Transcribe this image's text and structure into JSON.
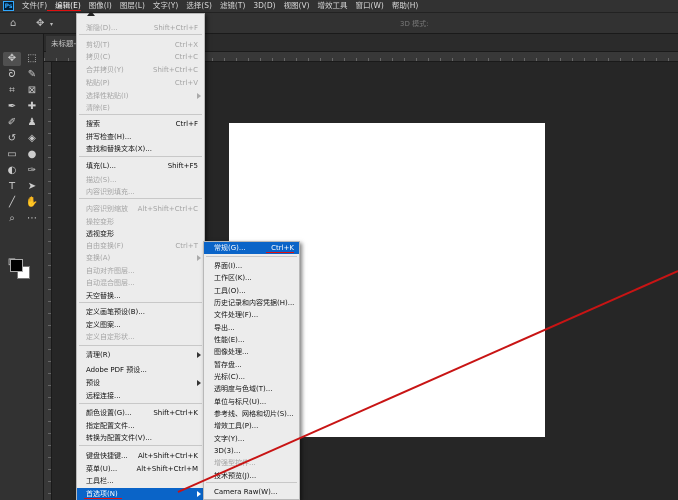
{
  "app": {
    "logo": "Ps"
  },
  "menubar": {
    "items": [
      "文件(F)",
      "编辑(E)",
      "图像(I)",
      "图层(L)",
      "文字(Y)",
      "选择(S)",
      "滤镜(T)",
      "3D(D)",
      "视图(V)",
      "增效工具",
      "窗口(W)",
      "帮助(H)"
    ]
  },
  "options": {
    "mode_label": "3D 模式:"
  },
  "document": {
    "tab_title": "未标题-"
  },
  "edit_menu": {
    "items": [
      {
        "label": "渐隐(D)...",
        "shortcut": "Shift+Ctrl+F",
        "disabled": true
      },
      {
        "label": "剪切(T)",
        "shortcut": "Ctrl+X",
        "disabled": true
      },
      {
        "label": "拷贝(C)",
        "shortcut": "Ctrl+C",
        "disabled": true
      },
      {
        "label": "合并拷贝(Y)",
        "shortcut": "Shift+Ctrl+C",
        "disabled": true
      },
      {
        "label": "粘贴(P)",
        "shortcut": "Ctrl+V",
        "disabled": true
      },
      {
        "label": "选择性粘贴(I)",
        "shortcut": "",
        "disabled": true,
        "submenu": true
      },
      {
        "label": "清除(E)",
        "shortcut": "",
        "disabled": true
      },
      {
        "label": "搜索",
        "shortcut": "Ctrl+F",
        "disabled": false
      },
      {
        "label": "拼写检查(H)...",
        "shortcut": "",
        "disabled": false
      },
      {
        "label": "查找和替换文本(X)...",
        "shortcut": "",
        "disabled": false
      },
      {
        "label": "填充(L)...",
        "shortcut": "Shift+F5",
        "disabled": false
      },
      {
        "label": "描边(S)...",
        "shortcut": "",
        "disabled": true
      },
      {
        "label": "内容识别填充...",
        "shortcut": "",
        "disabled": true
      },
      {
        "label": "内容识别缩放",
        "shortcut": "Alt+Shift+Ctrl+C",
        "disabled": true
      },
      {
        "label": "操控变形",
        "shortcut": "",
        "disabled": true
      },
      {
        "label": "透视变形",
        "shortcut": "",
        "disabled": false
      },
      {
        "label": "自由变换(F)",
        "shortcut": "Ctrl+T",
        "disabled": true
      },
      {
        "label": "变换(A)",
        "shortcut": "",
        "disabled": true,
        "submenu": true
      },
      {
        "label": "自动对齐图层...",
        "shortcut": "",
        "disabled": true
      },
      {
        "label": "自动混合图层...",
        "shortcut": "",
        "disabled": true
      },
      {
        "label": "天空替换...",
        "shortcut": "",
        "disabled": false
      },
      {
        "label": "定义画笔预设(B)...",
        "shortcut": "",
        "disabled": false
      },
      {
        "label": "定义图案...",
        "shortcut": "",
        "disabled": false
      },
      {
        "label": "定义自定形状...",
        "shortcut": "",
        "disabled": true
      },
      {
        "label": "清理(R)",
        "shortcut": "",
        "disabled": false,
        "submenu": true
      },
      {
        "label": "Adobe PDF 预设...",
        "shortcut": "",
        "disabled": false
      },
      {
        "label": "预设",
        "shortcut": "",
        "disabled": false,
        "submenu": true
      },
      {
        "label": "远程连接...",
        "shortcut": "",
        "disabled": false
      },
      {
        "label": "颜色设置(G)...",
        "shortcut": "Shift+Ctrl+K",
        "disabled": false
      },
      {
        "label": "指定配置文件...",
        "shortcut": "",
        "disabled": false
      },
      {
        "label": "转换为配置文件(V)...",
        "shortcut": "",
        "disabled": false
      },
      {
        "label": "键盘快捷键...",
        "shortcut": "Alt+Shift+Ctrl+K",
        "disabled": false
      },
      {
        "label": "菜单(U)...",
        "shortcut": "Alt+Shift+Ctrl+M",
        "disabled": false
      },
      {
        "label": "工具栏...",
        "shortcut": "",
        "disabled": false
      },
      {
        "label": "首选项(N)",
        "shortcut": "",
        "disabled": false,
        "submenu": true,
        "highlighted": true
      }
    ]
  },
  "prefs_submenu": {
    "items": [
      {
        "label": "常规(G)...",
        "shortcut": "Ctrl+K",
        "highlighted": true
      },
      {
        "label": "界面(I)...",
        "shortcut": ""
      },
      {
        "label": "工作区(K)...",
        "shortcut": ""
      },
      {
        "label": "工具(O)...",
        "shortcut": ""
      },
      {
        "label": "历史记录和内容凭据(H)...",
        "shortcut": ""
      },
      {
        "label": "文件处理(F)...",
        "shortcut": ""
      },
      {
        "label": "导出...",
        "shortcut": ""
      },
      {
        "label": "性能(E)...",
        "shortcut": ""
      },
      {
        "label": "图像处理...",
        "shortcut": ""
      },
      {
        "label": "暂存盘...",
        "shortcut": ""
      },
      {
        "label": "光标(C)...",
        "shortcut": ""
      },
      {
        "label": "透明度与色域(T)...",
        "shortcut": ""
      },
      {
        "label": "单位与标尺(U)...",
        "shortcut": ""
      },
      {
        "label": "参考线、网格和切片(S)...",
        "shortcut": ""
      },
      {
        "label": "增效工具(P)...",
        "shortcut": ""
      },
      {
        "label": "文字(Y)...",
        "shortcut": ""
      },
      {
        "label": "3D(3)...",
        "shortcut": ""
      },
      {
        "label": "增强型控件...",
        "shortcut": "",
        "disabled": true
      },
      {
        "label": "技术预览(J)...",
        "shortcut": ""
      },
      {
        "label": "Camera Raw(W)...",
        "shortcut": ""
      }
    ]
  },
  "colors": {
    "highlight": "#0a64c8",
    "annotation": "#c81414"
  }
}
